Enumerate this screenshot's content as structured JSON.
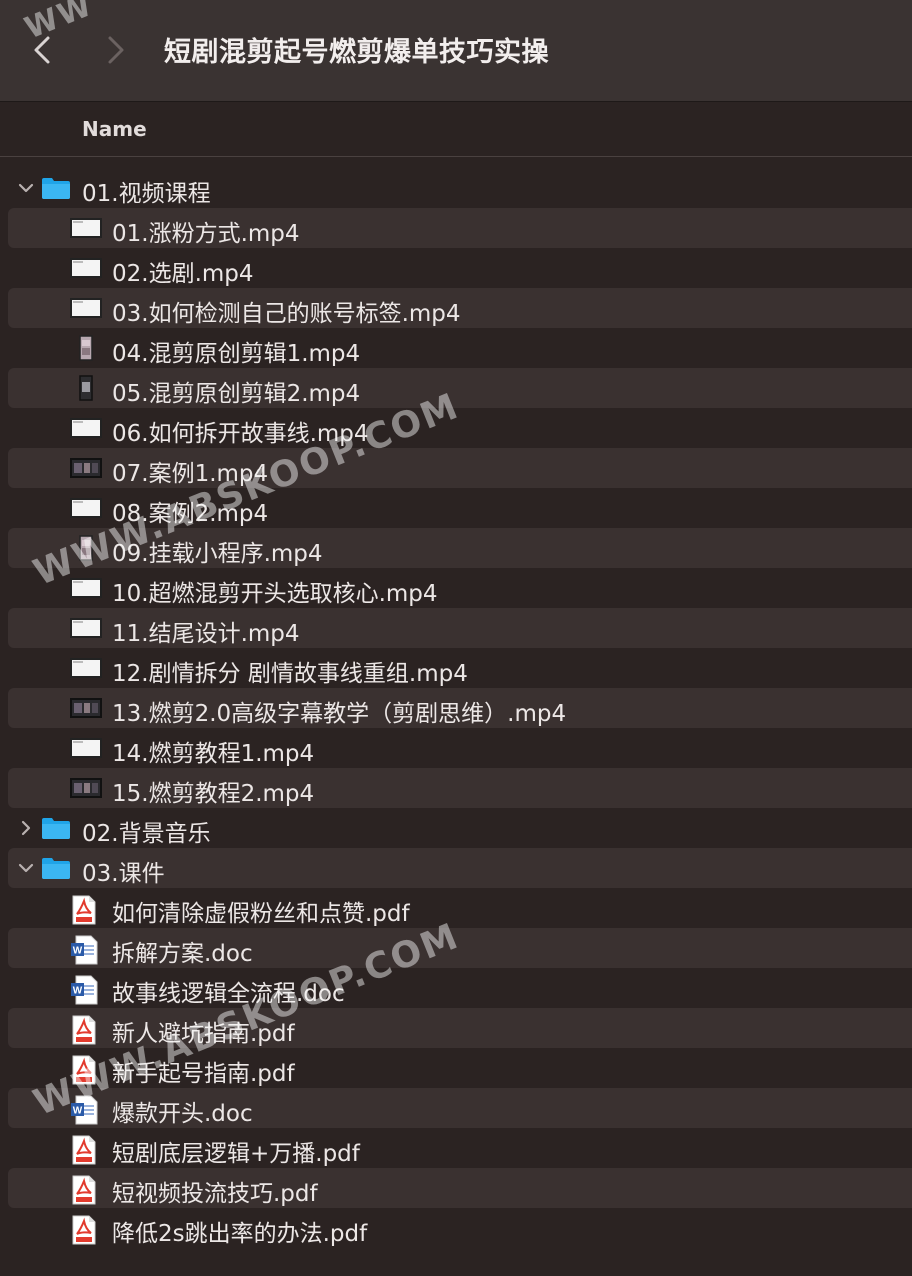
{
  "window": {
    "title": "短剧混剪起号燃剪爆单技巧实操"
  },
  "header": {
    "name_col": "Name"
  },
  "watermark": "WWW.ABSKOOP.COM",
  "watermark_top": "WW",
  "tree": [
    {
      "kind": "folder",
      "label": "01.视频课程",
      "expanded": true
    },
    {
      "kind": "video",
      "label": "01.涨粉方式.mp4",
      "thumb": "screen"
    },
    {
      "kind": "video",
      "label": "02.选剧.mp4",
      "thumb": "screen"
    },
    {
      "kind": "video",
      "label": "03.如何检测自己的账号标签.mp4",
      "thumb": "screen"
    },
    {
      "kind": "video",
      "label": "04.混剪原创剪辑1.mp4",
      "thumb": "portrait"
    },
    {
      "kind": "video",
      "label": "05.混剪原创剪辑2.mp4",
      "thumb": "portrait-dark"
    },
    {
      "kind": "video",
      "label": "06.如何拆开故事线.mp4",
      "thumb": "screen"
    },
    {
      "kind": "video",
      "label": "07.案例1.mp4",
      "thumb": "dark"
    },
    {
      "kind": "video",
      "label": "08.案例2.mp4",
      "thumb": "screen"
    },
    {
      "kind": "video",
      "label": "09.挂载小程序.mp4",
      "thumb": "portrait"
    },
    {
      "kind": "video",
      "label": "10.超燃混剪开头选取核心.mp4",
      "thumb": "screen"
    },
    {
      "kind": "video",
      "label": "11.结尾设计.mp4",
      "thumb": "screen"
    },
    {
      "kind": "video",
      "label": "12.剧情拆分 剧情故事线重组.mp4",
      "thumb": "screen"
    },
    {
      "kind": "video",
      "label": "13.燃剪2.0高级字幕教学（剪剧思维）.mp4",
      "thumb": "dark"
    },
    {
      "kind": "video",
      "label": "14.燃剪教程1.mp4",
      "thumb": "screen"
    },
    {
      "kind": "video",
      "label": "15.燃剪教程2.mp4",
      "thumb": "dark"
    },
    {
      "kind": "folder",
      "label": "02.背景音乐",
      "expanded": false
    },
    {
      "kind": "folder",
      "label": "03.课件",
      "expanded": true
    },
    {
      "kind": "pdf",
      "label": "如何清除虚假粉丝和点赞.pdf"
    },
    {
      "kind": "doc",
      "label": "拆解方案.doc"
    },
    {
      "kind": "doc",
      "label": "故事线逻辑全流程.doc"
    },
    {
      "kind": "pdf",
      "label": "新人避坑指南.pdf"
    },
    {
      "kind": "pdf",
      "label": "新手起号指南.pdf"
    },
    {
      "kind": "doc",
      "label": "爆款开头.doc"
    },
    {
      "kind": "pdf",
      "label": "短剧底层逻辑+万播.pdf"
    },
    {
      "kind": "pdf",
      "label": "短视频投流技巧.pdf"
    },
    {
      "kind": "pdf",
      "label": "降低2s跳出率的办法.pdf"
    }
  ],
  "colors": {
    "folder": "#1fa4e8",
    "pdf": "#e23b2e",
    "doc": "#2a5aa8",
    "row_alt": "#3a3130",
    "bg": "#2b2322"
  }
}
